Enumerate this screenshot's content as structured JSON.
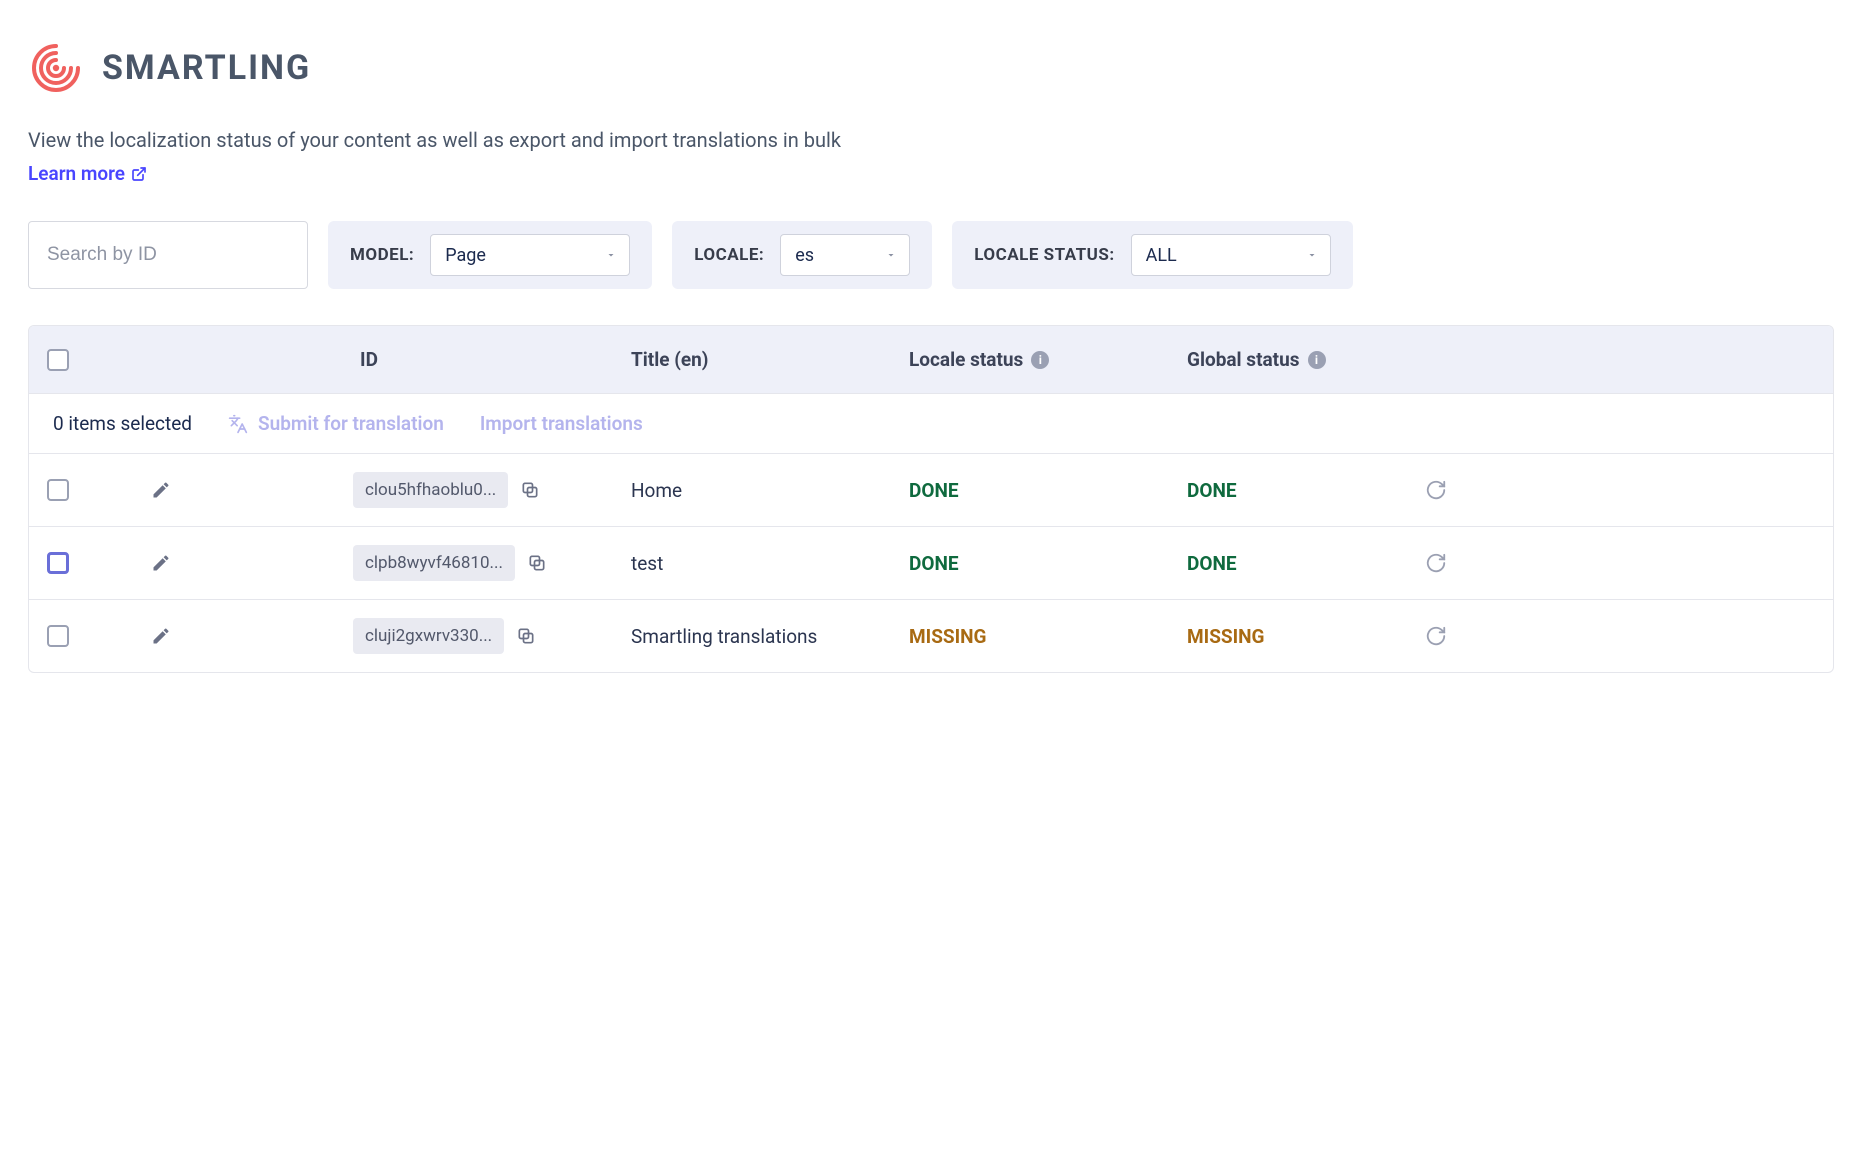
{
  "logo": {
    "text": "SMARTLING"
  },
  "description": "View the localization status of your content as well as export and import translations in bulk",
  "learn_more": "Learn more",
  "filters": {
    "search_placeholder": "Search by ID",
    "model_label": "MODEL:",
    "model_value": "Page",
    "locale_label": "LOCALE:",
    "locale_value": "es",
    "locale_status_label": "LOCALE STATUS:",
    "locale_status_value": "ALL"
  },
  "table": {
    "headers": {
      "id": "ID",
      "title": "Title (en)",
      "locale_status": "Locale status",
      "global_status": "Global status"
    },
    "selected_text": "0 items selected",
    "submit_label": "Submit for translation",
    "import_label": "Import translations",
    "rows": [
      {
        "id": "clou5hfhaoblu0...",
        "title": "Home",
        "locale_status": "DONE",
        "global_status": "DONE"
      },
      {
        "id": "clpb8wyvf46810...",
        "title": "test",
        "locale_status": "DONE",
        "global_status": "DONE"
      },
      {
        "id": "cluji2gxwrv330...",
        "title": "Smartling translations",
        "locale_status": "MISSING",
        "global_status": "MISSING"
      }
    ]
  },
  "colors": {
    "link": "#4945ff",
    "done": "#0f6a3e",
    "missing": "#a86a13",
    "panel": "#eef0f9"
  }
}
